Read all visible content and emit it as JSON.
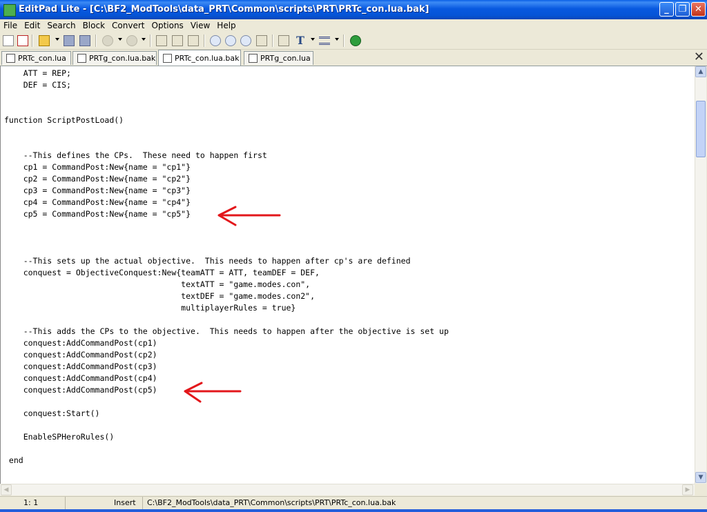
{
  "window": {
    "title": "EditPad Lite - [C:\\BF2_ModTools\\data_PRT\\Common\\scripts\\PRT\\PRTc_con.lua.bak]",
    "controls": {
      "minimize": "_",
      "restore": "❐",
      "close": "✕"
    }
  },
  "menu": [
    "File",
    "Edit",
    "Search",
    "Block",
    "Convert",
    "Options",
    "View",
    "Help"
  ],
  "toolbar": {
    "icons": [
      "new-file-icon",
      "close-file-icon",
      "open-folder-icon",
      "save-icon",
      "save-all-icon",
      "undo-icon",
      "redo-icon",
      "cut-icon",
      "copy-icon",
      "paste-icon",
      "find-icon",
      "find-next-icon",
      "find-previous-icon",
      "replace-icon",
      "indent-icon",
      "font-icon",
      "line-break-icon",
      "web-icon"
    ],
    "font_glyph": "T"
  },
  "tabs": [
    {
      "label": "PRTc_con.lua",
      "active": false
    },
    {
      "label": "PRTg_con.lua.bak",
      "active": false
    },
    {
      "label": "PRTc_con.lua.bak",
      "active": true
    },
    {
      "label": "PRTg_con.lua",
      "active": false
    }
  ],
  "close_all_tabs": "✕",
  "editor": {
    "lines": [
      "    ATT = REP;",
      "    DEF = CIS;",
      "",
      "",
      "function ScriptPostLoad()",
      "",
      "",
      "    --This defines the CPs.  These need to happen first",
      "    cp1 = CommandPost:New{name = \"cp1\"}",
      "    cp2 = CommandPost:New{name = \"cp2\"}",
      "    cp3 = CommandPost:New{name = \"cp3\"}",
      "    cp4 = CommandPost:New{name = \"cp4\"}",
      "    cp5 = CommandPost:New{name = \"cp5\"}",
      "",
      "",
      "",
      "    --This sets up the actual objective.  This needs to happen after cp's are defined",
      "    conquest = ObjectiveConquest:New{teamATT = ATT, teamDEF = DEF,",
      "                                     textATT = \"game.modes.con\",",
      "                                     textDEF = \"game.modes.con2\",",
      "                                     multiplayerRules = true}",
      "",
      "    --This adds the CPs to the objective.  This needs to happen after the objective is set up",
      "    conquest:AddCommandPost(cp1)",
      "    conquest:AddCommandPost(cp2)",
      "    conquest:AddCommandPost(cp3)",
      "    conquest:AddCommandPost(cp4)",
      "    conquest:AddCommandPost(cp5)",
      "",
      "    conquest:Start()",
      "",
      "    EnableSPHeroRules()",
      "",
      " end"
    ],
    "annotation_color": "#e3171b"
  },
  "scrollbar": {
    "up": "▲",
    "down": "▼",
    "left": "◀",
    "right": "▶"
  },
  "status": {
    "position": "1: 1",
    "mode": "Insert",
    "path": "C:\\BF2_ModTools\\data_PRT\\Common\\scripts\\PRT\\PRTc_con.lua.bak"
  }
}
